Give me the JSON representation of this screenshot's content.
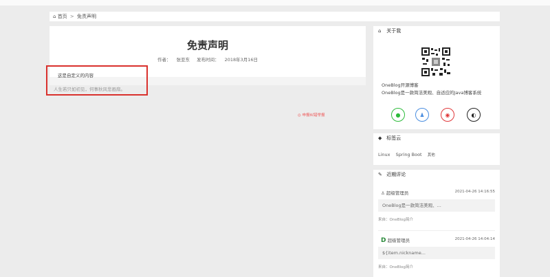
{
  "breadcrumb": {
    "home": "首页",
    "separator": ">",
    "current": "免责声明"
  },
  "article": {
    "title": "免责声明",
    "author_label": "作者：",
    "author": "张亚东",
    "publish_label": "发布时间：",
    "publish_date": "2018年3月16日",
    "custom_content": "这是自定义的内容",
    "quote": "人生若只如初见，何事秋风悲画扇。",
    "report": "◎ 申报纠错举报"
  },
  "sidebar": {
    "about": {
      "title": "关于我",
      "line1": "OneBlog开源博客",
      "line2": "OneBlog是一款简洁美观、自适应的Java博客系统"
    },
    "tags": {
      "title": "标签云",
      "items": [
        "Linux",
        "Spring Boot",
        "其他"
      ]
    },
    "comments": {
      "title": "近期评论",
      "items": [
        {
          "user": "超级管理员",
          "time": "2021-04-26 14:16:55",
          "body": "OneBlog是一款简洁美观、...",
          "source": "来自：OneBlog简介"
        },
        {
          "user": "超级管理员",
          "time": "2021-04-26 14:04:14",
          "body": "${item.nickname...",
          "source": "来自：OneBlog简介"
        }
      ]
    }
  },
  "colors": {
    "highlight_border": "#d9302c",
    "wechat": "#2dbb3b",
    "qq": "#4a8ee0",
    "weibo": "#e0383a",
    "github": "#222222"
  }
}
